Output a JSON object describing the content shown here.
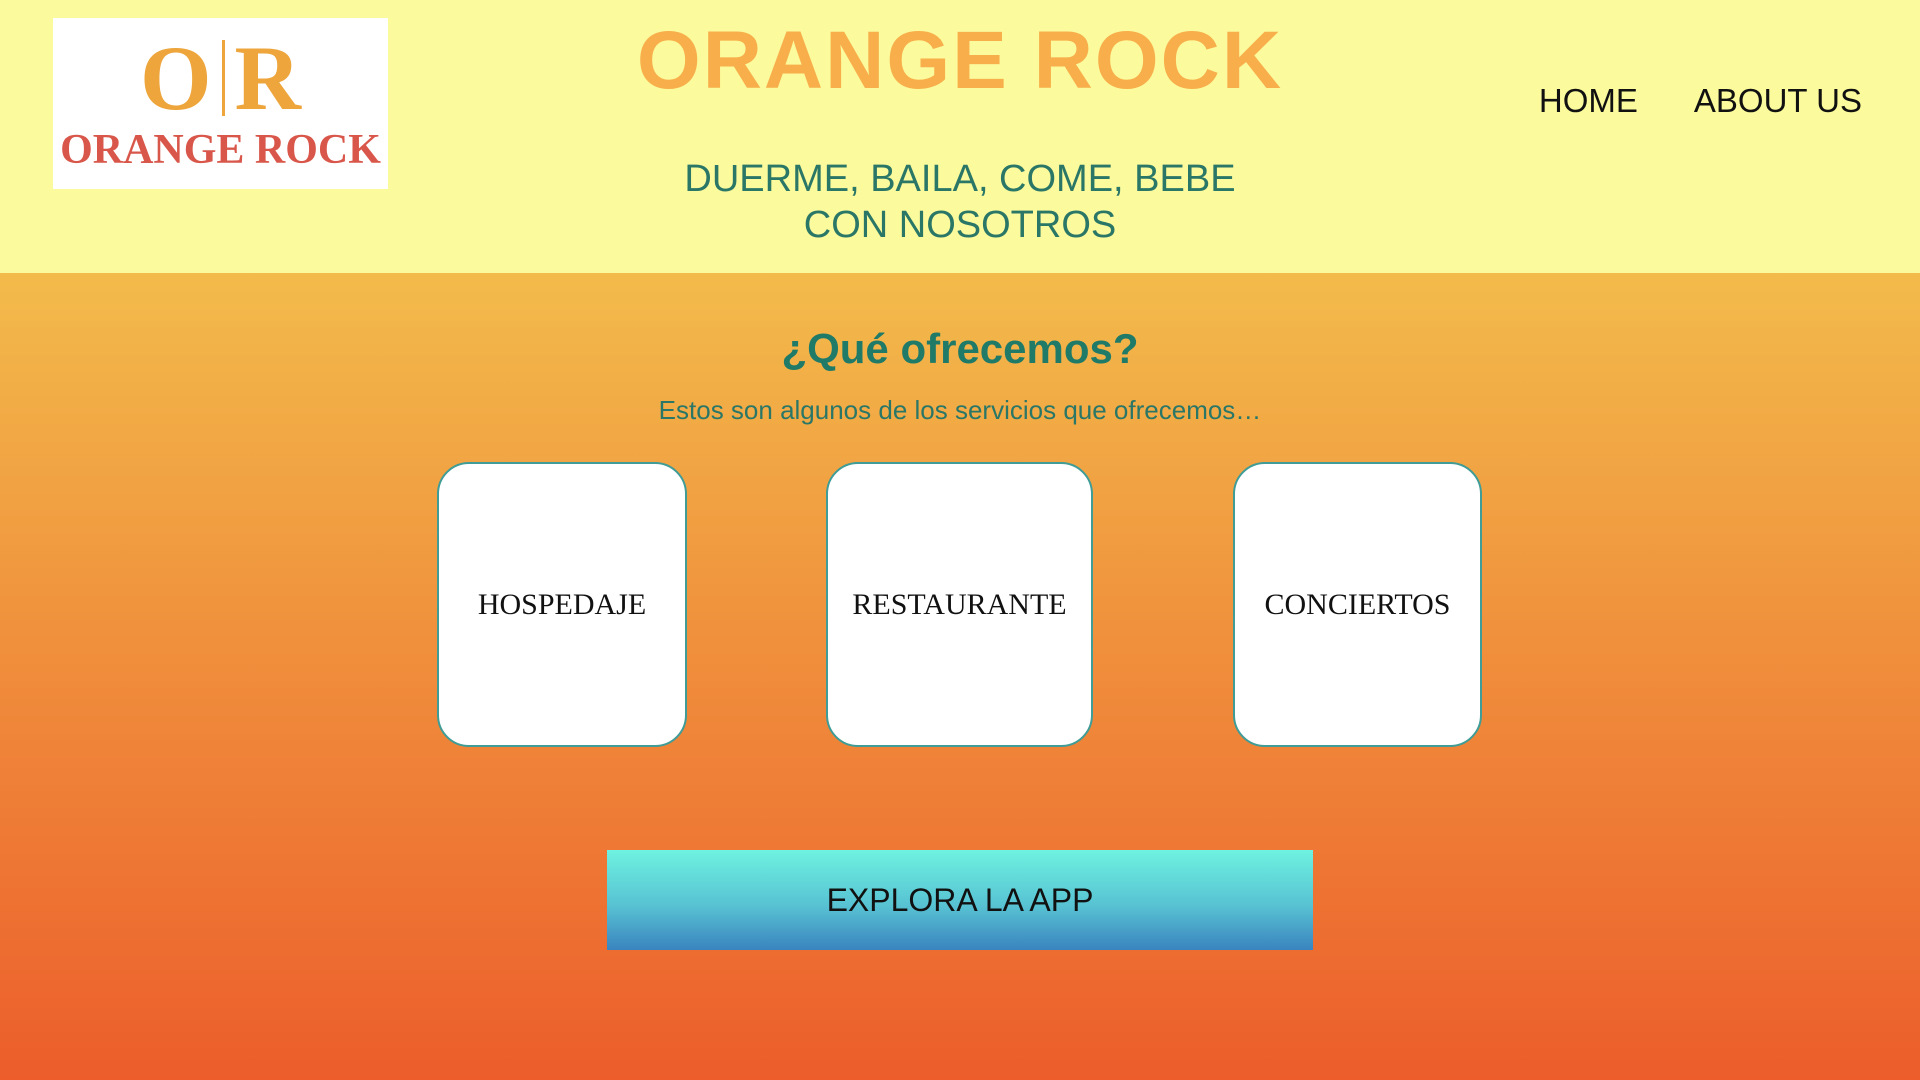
{
  "header": {
    "logo": {
      "mark_left": "O",
      "mark_right": "R",
      "name": "ORANGE ROCK"
    },
    "title": "ORANGE ROCK",
    "tagline_line1": "DUERME, BAILA, COME, BEBE",
    "tagline_line2": "CON NOSOTROS",
    "nav": [
      {
        "label": "HOME"
      },
      {
        "label": "ABOUT US"
      }
    ]
  },
  "main": {
    "title": "¿Qué ofrecemos?",
    "subtitle": "Estos son algunos de los servicios que ofrecemos…",
    "services": [
      {
        "label": "HOSPEDAJE"
      },
      {
        "label": "RESTAURANTE"
      },
      {
        "label": "CONCIERTOS"
      }
    ],
    "cta_label": "EXPLORA LA APP"
  },
  "colors": {
    "header_bg": "#fbfa9c",
    "title": "#f8ae4a",
    "accent_green": "#1f7a68",
    "gradient_top": "#f3bb4b",
    "gradient_bottom": "#ec5d2b",
    "cta_top": "#6ef2e0",
    "cta_bottom": "#3a84bf"
  }
}
